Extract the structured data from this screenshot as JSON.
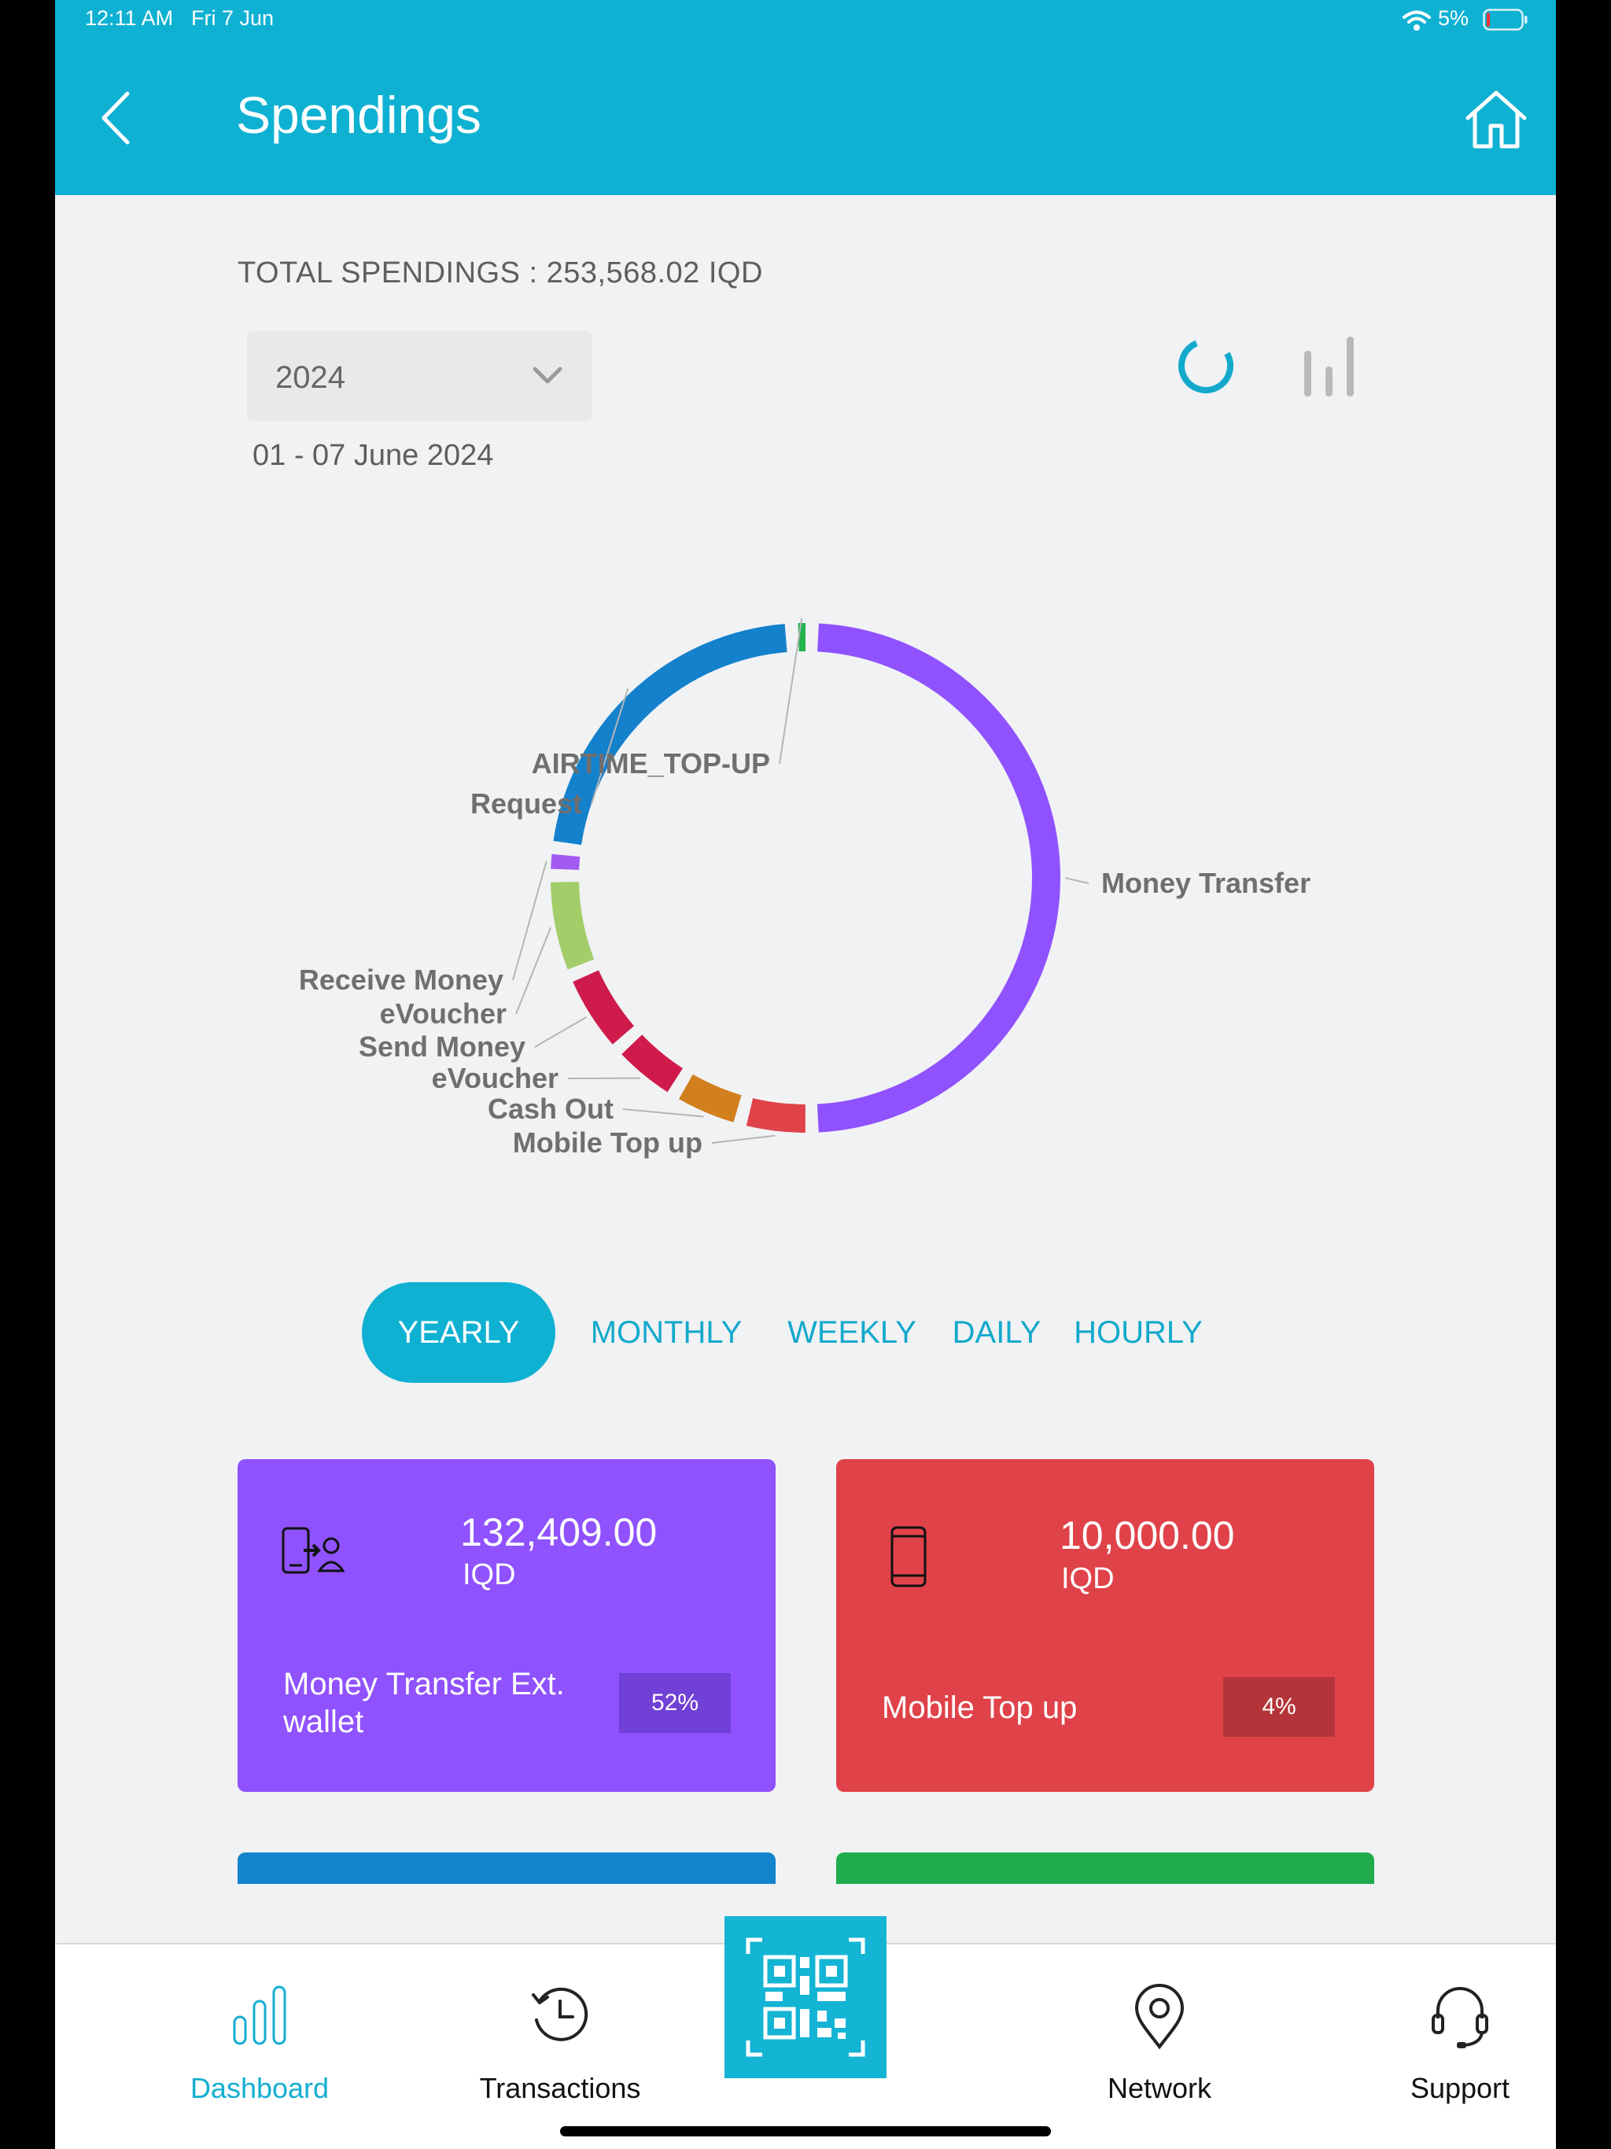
{
  "status_bar": {
    "time": "12:11 AM",
    "date": "Fri 7 Jun",
    "battery": "5%"
  },
  "header": {
    "title": "Spendings",
    "back_icon": "chevron-left-icon",
    "home_icon": "home-icon",
    "color": "#0fb1d2"
  },
  "summary": {
    "total_label": "TOTAL SPENDINGS : 253,568.02 IQD",
    "year_select": "2024",
    "date_range": "01 - 07 June 2024",
    "toggles": [
      "donut-chart-icon",
      "bar-chart-icon"
    ]
  },
  "chart_data": {
    "type": "pie",
    "style": "donut",
    "categories": [
      "Money Transfer",
      "Mobile Top up",
      "Cash Out",
      "eVoucher",
      "Send Money",
      "eVoucher",
      "Receive Money",
      "Request",
      "AIRTIME_TOP-UP"
    ],
    "values": [
      52,
      4,
      4,
      4,
      5,
      6,
      1,
      23,
      0.5
    ],
    "colors": [
      "#8f52fe",
      "#e0424a",
      "#d27f1e",
      "#cf1a4c",
      "#cf1a4c",
      "#a3cd68",
      "#a35af2",
      "#1481cc",
      "#24b24e"
    ],
    "legend": "labels around ring"
  },
  "periods": {
    "items": [
      "YEARLY",
      "MONTHLY",
      "WEEKLY",
      "DAILY",
      "HOURLY"
    ],
    "active": "YEARLY"
  },
  "cards": [
    {
      "amount": "132,409.00",
      "currency": "IQD",
      "name": "Money Transfer Ext. wallet",
      "percent": "52%",
      "color": "#8f52fe",
      "icon": "money-transfer-icon"
    },
    {
      "amount": "10,000.00",
      "currency": "IQD",
      "name": "Mobile Top up",
      "percent": "4%",
      "color": "#e0424a",
      "icon": "mobile-phone-icon"
    }
  ],
  "partial_cards": [
    "#1283cc",
    "#20ac4c"
  ],
  "bottom_nav": {
    "items": [
      "Dashboard",
      "Transactions",
      "Network",
      "Support"
    ],
    "active": "Dashboard",
    "qr_icon": "qr-code-icon",
    "active_color": "#14aed1"
  }
}
